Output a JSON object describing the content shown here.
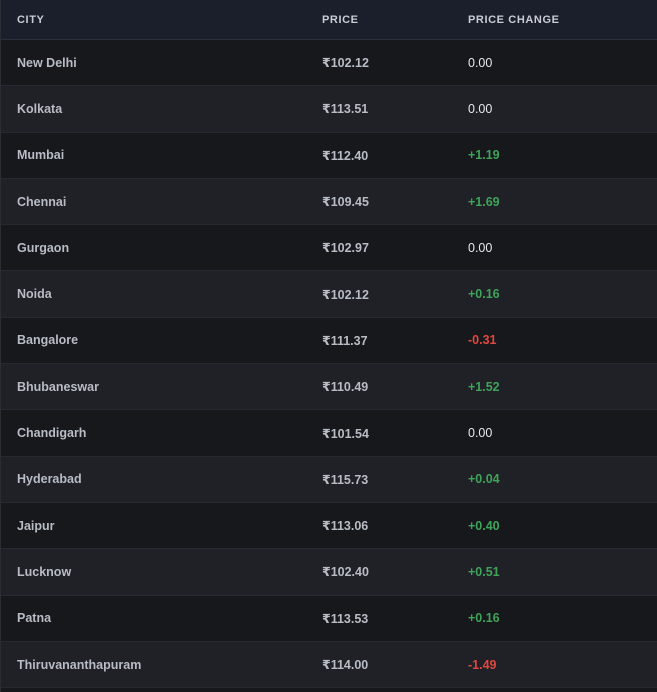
{
  "table": {
    "columns": {
      "city": "CITY",
      "price": "PRICE",
      "change": "PRICE CHANGE"
    },
    "rows": [
      {
        "city": "New Delhi",
        "price": "₹102.12",
        "change": "0.00"
      },
      {
        "city": "Kolkata",
        "price": "₹113.51",
        "change": "0.00"
      },
      {
        "city": "Mumbai",
        "price": "₹112.40",
        "change": "+1.19"
      },
      {
        "city": "Chennai",
        "price": "₹109.45",
        "change": "+1.69"
      },
      {
        "city": "Gurgaon",
        "price": "₹102.97",
        "change": "0.00"
      },
      {
        "city": "Noida",
        "price": "₹102.12",
        "change": "+0.16"
      },
      {
        "city": "Bangalore",
        "price": "₹111.37",
        "change": "-0.31"
      },
      {
        "city": "Bhubaneswar",
        "price": "₹110.49",
        "change": "+1.52"
      },
      {
        "city": "Chandigarh",
        "price": "₹101.54",
        "change": "0.00"
      },
      {
        "city": "Hyderabad",
        "price": "₹115.73",
        "change": "+0.04"
      },
      {
        "city": "Jaipur",
        "price": "₹113.06",
        "change": "+0.40"
      },
      {
        "city": "Lucknow",
        "price": "₹102.40",
        "change": "+0.51"
      },
      {
        "city": "Patna",
        "price": "₹113.53",
        "change": "+0.16"
      },
      {
        "city": "Thiruvananthapuram",
        "price": "₹114.00",
        "change": "-1.49"
      }
    ]
  },
  "colors": {
    "positive": "#3fa35a",
    "negative": "#e0473f",
    "neutral": "#e8e9ec"
  }
}
